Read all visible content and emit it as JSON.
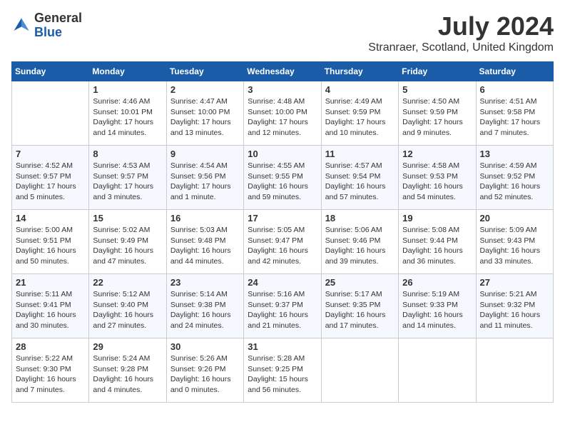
{
  "logo": {
    "general": "General",
    "blue": "Blue"
  },
  "title": {
    "month_year": "July 2024",
    "location": "Stranraer, Scotland, United Kingdom"
  },
  "calendar": {
    "headers": [
      "Sunday",
      "Monday",
      "Tuesday",
      "Wednesday",
      "Thursday",
      "Friday",
      "Saturday"
    ],
    "weeks": [
      [
        {
          "day": "",
          "info": ""
        },
        {
          "day": "1",
          "info": "Sunrise: 4:46 AM\nSunset: 10:01 PM\nDaylight: 17 hours\nand 14 minutes."
        },
        {
          "day": "2",
          "info": "Sunrise: 4:47 AM\nSunset: 10:00 PM\nDaylight: 17 hours\nand 13 minutes."
        },
        {
          "day": "3",
          "info": "Sunrise: 4:48 AM\nSunset: 10:00 PM\nDaylight: 17 hours\nand 12 minutes."
        },
        {
          "day": "4",
          "info": "Sunrise: 4:49 AM\nSunset: 9:59 PM\nDaylight: 17 hours\nand 10 minutes."
        },
        {
          "day": "5",
          "info": "Sunrise: 4:50 AM\nSunset: 9:59 PM\nDaylight: 17 hours\nand 9 minutes."
        },
        {
          "day": "6",
          "info": "Sunrise: 4:51 AM\nSunset: 9:58 PM\nDaylight: 17 hours\nand 7 minutes."
        }
      ],
      [
        {
          "day": "7",
          "info": "Sunrise: 4:52 AM\nSunset: 9:57 PM\nDaylight: 17 hours\nand 5 minutes."
        },
        {
          "day": "8",
          "info": "Sunrise: 4:53 AM\nSunset: 9:57 PM\nDaylight: 17 hours\nand 3 minutes."
        },
        {
          "day": "9",
          "info": "Sunrise: 4:54 AM\nSunset: 9:56 PM\nDaylight: 17 hours\nand 1 minute."
        },
        {
          "day": "10",
          "info": "Sunrise: 4:55 AM\nSunset: 9:55 PM\nDaylight: 16 hours\nand 59 minutes."
        },
        {
          "day": "11",
          "info": "Sunrise: 4:57 AM\nSunset: 9:54 PM\nDaylight: 16 hours\nand 57 minutes."
        },
        {
          "day": "12",
          "info": "Sunrise: 4:58 AM\nSunset: 9:53 PM\nDaylight: 16 hours\nand 54 minutes."
        },
        {
          "day": "13",
          "info": "Sunrise: 4:59 AM\nSunset: 9:52 PM\nDaylight: 16 hours\nand 52 minutes."
        }
      ],
      [
        {
          "day": "14",
          "info": "Sunrise: 5:00 AM\nSunset: 9:51 PM\nDaylight: 16 hours\nand 50 minutes."
        },
        {
          "day": "15",
          "info": "Sunrise: 5:02 AM\nSunset: 9:49 PM\nDaylight: 16 hours\nand 47 minutes."
        },
        {
          "day": "16",
          "info": "Sunrise: 5:03 AM\nSunset: 9:48 PM\nDaylight: 16 hours\nand 44 minutes."
        },
        {
          "day": "17",
          "info": "Sunrise: 5:05 AM\nSunset: 9:47 PM\nDaylight: 16 hours\nand 42 minutes."
        },
        {
          "day": "18",
          "info": "Sunrise: 5:06 AM\nSunset: 9:46 PM\nDaylight: 16 hours\nand 39 minutes."
        },
        {
          "day": "19",
          "info": "Sunrise: 5:08 AM\nSunset: 9:44 PM\nDaylight: 16 hours\nand 36 minutes."
        },
        {
          "day": "20",
          "info": "Sunrise: 5:09 AM\nSunset: 9:43 PM\nDaylight: 16 hours\nand 33 minutes."
        }
      ],
      [
        {
          "day": "21",
          "info": "Sunrise: 5:11 AM\nSunset: 9:41 PM\nDaylight: 16 hours\nand 30 minutes."
        },
        {
          "day": "22",
          "info": "Sunrise: 5:12 AM\nSunset: 9:40 PM\nDaylight: 16 hours\nand 27 minutes."
        },
        {
          "day": "23",
          "info": "Sunrise: 5:14 AM\nSunset: 9:38 PM\nDaylight: 16 hours\nand 24 minutes."
        },
        {
          "day": "24",
          "info": "Sunrise: 5:16 AM\nSunset: 9:37 PM\nDaylight: 16 hours\nand 21 minutes."
        },
        {
          "day": "25",
          "info": "Sunrise: 5:17 AM\nSunset: 9:35 PM\nDaylight: 16 hours\nand 17 minutes."
        },
        {
          "day": "26",
          "info": "Sunrise: 5:19 AM\nSunset: 9:33 PM\nDaylight: 16 hours\nand 14 minutes."
        },
        {
          "day": "27",
          "info": "Sunrise: 5:21 AM\nSunset: 9:32 PM\nDaylight: 16 hours\nand 11 minutes."
        }
      ],
      [
        {
          "day": "28",
          "info": "Sunrise: 5:22 AM\nSunset: 9:30 PM\nDaylight: 16 hours\nand 7 minutes."
        },
        {
          "day": "29",
          "info": "Sunrise: 5:24 AM\nSunset: 9:28 PM\nDaylight: 16 hours\nand 4 minutes."
        },
        {
          "day": "30",
          "info": "Sunrise: 5:26 AM\nSunset: 9:26 PM\nDaylight: 16 hours\nand 0 minutes."
        },
        {
          "day": "31",
          "info": "Sunrise: 5:28 AM\nSunset: 9:25 PM\nDaylight: 15 hours\nand 56 minutes."
        },
        {
          "day": "",
          "info": ""
        },
        {
          "day": "",
          "info": ""
        },
        {
          "day": "",
          "info": ""
        }
      ]
    ]
  }
}
